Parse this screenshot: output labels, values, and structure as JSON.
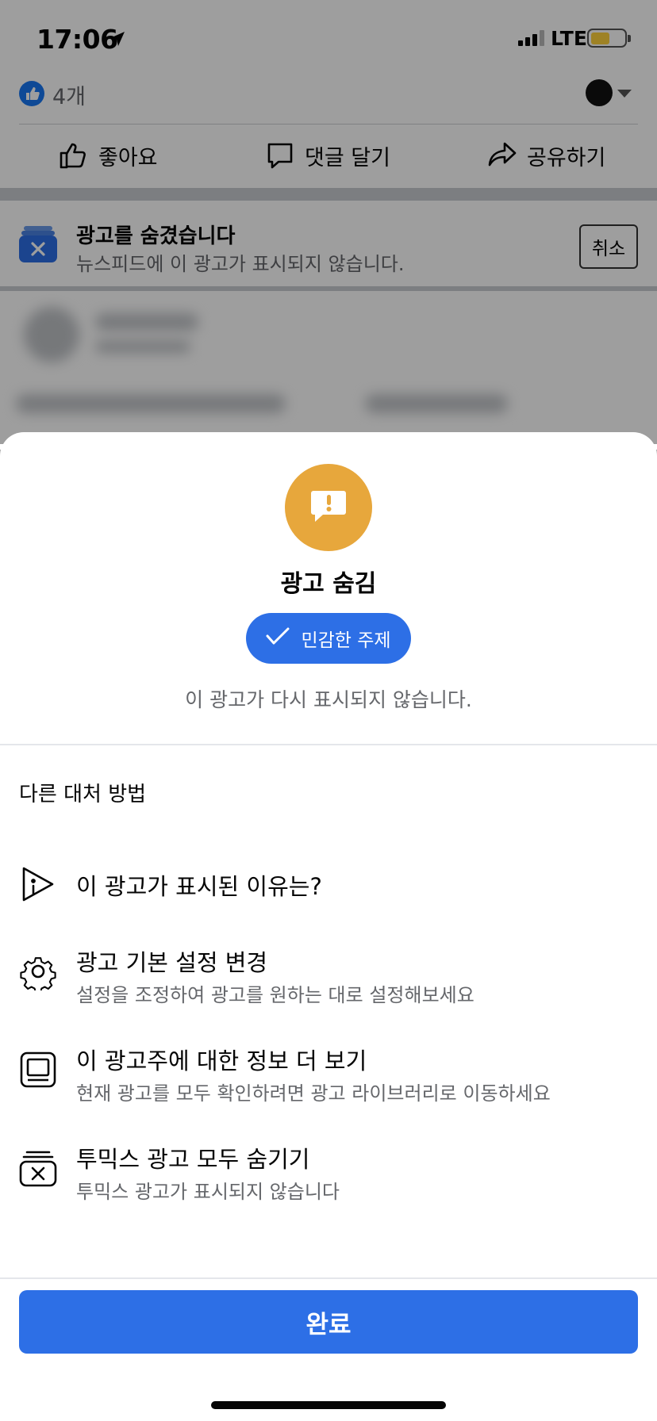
{
  "status_bar": {
    "time": "17:06",
    "network": "LTE",
    "battery_color": "#ffd23c"
  },
  "post": {
    "likes_count": "4개",
    "actions": {
      "like": "좋아요",
      "comment": "댓글 달기",
      "share": "공유하기"
    }
  },
  "hidden_notice": {
    "title": "광고를 숨겼습니다",
    "subtitle": "뉴스피드에 이 광고가 표시되지 않습니다.",
    "cancel_label": "취소"
  },
  "sheet": {
    "title": "광고 숨김",
    "reason_pill": "민감한 주제",
    "subtitle": "이 광고가 다시 표시되지 않습니다.",
    "section_heading": "다른 대처 방법",
    "options": [
      {
        "title": "이 광고가 표시된 이유는?",
        "desc": "",
        "icon": "play-triangle-info-icon"
      },
      {
        "title": "광고 기본 설정 변경",
        "desc": "설정을 조정하여 광고를 원하는 대로 설정해보세요",
        "icon": "gear-icon"
      },
      {
        "title": "이 광고주에 대한 정보 더 보기",
        "desc": "현재 광고를 모두 확인하려면 광고 라이브러리로 이동하세요",
        "icon": "ad-library-icon"
      },
      {
        "title": "투믹스 광고 모두 숨기기",
        "desc": "투믹스 광고가 표시되지 않습니다",
        "icon": "hide-ads-icon"
      }
    ],
    "done_label": "완료"
  },
  "colors": {
    "accent": "#2d6fe6",
    "alert": "#e7a73c",
    "muted_text": "#65676b"
  }
}
